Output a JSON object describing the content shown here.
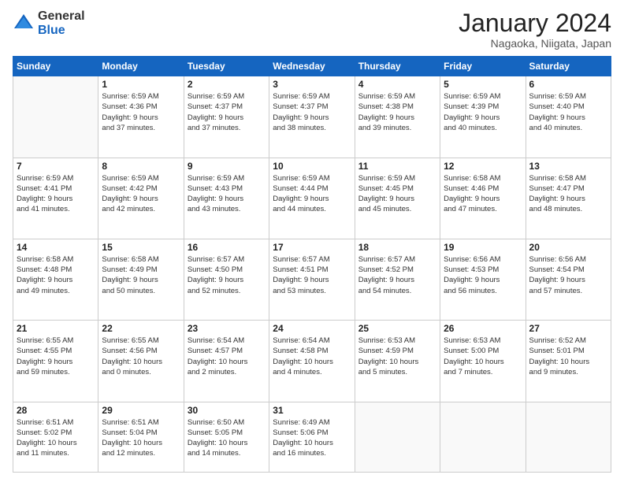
{
  "header": {
    "logo_general": "General",
    "logo_blue": "Blue",
    "title": "January 2024",
    "location": "Nagaoka, Niigata, Japan"
  },
  "weekdays": [
    "Sunday",
    "Monday",
    "Tuesday",
    "Wednesday",
    "Thursday",
    "Friday",
    "Saturday"
  ],
  "weeks": [
    [
      {
        "day": "",
        "info": ""
      },
      {
        "day": "1",
        "info": "Sunrise: 6:59 AM\nSunset: 4:36 PM\nDaylight: 9 hours\nand 37 minutes."
      },
      {
        "day": "2",
        "info": "Sunrise: 6:59 AM\nSunset: 4:37 PM\nDaylight: 9 hours\nand 37 minutes."
      },
      {
        "day": "3",
        "info": "Sunrise: 6:59 AM\nSunset: 4:37 PM\nDaylight: 9 hours\nand 38 minutes."
      },
      {
        "day": "4",
        "info": "Sunrise: 6:59 AM\nSunset: 4:38 PM\nDaylight: 9 hours\nand 39 minutes."
      },
      {
        "day": "5",
        "info": "Sunrise: 6:59 AM\nSunset: 4:39 PM\nDaylight: 9 hours\nand 40 minutes."
      },
      {
        "day": "6",
        "info": "Sunrise: 6:59 AM\nSunset: 4:40 PM\nDaylight: 9 hours\nand 40 minutes."
      }
    ],
    [
      {
        "day": "7",
        "info": ""
      },
      {
        "day": "8",
        "info": "Sunrise: 6:59 AM\nSunset: 4:42 PM\nDaylight: 9 hours\nand 42 minutes."
      },
      {
        "day": "9",
        "info": "Sunrise: 6:59 AM\nSunset: 4:43 PM\nDaylight: 9 hours\nand 43 minutes."
      },
      {
        "day": "10",
        "info": "Sunrise: 6:59 AM\nSunset: 4:44 PM\nDaylight: 9 hours\nand 44 minutes."
      },
      {
        "day": "11",
        "info": "Sunrise: 6:59 AM\nSunset: 4:45 PM\nDaylight: 9 hours\nand 45 minutes."
      },
      {
        "day": "12",
        "info": "Sunrise: 6:58 AM\nSunset: 4:46 PM\nDaylight: 9 hours\nand 47 minutes."
      },
      {
        "day": "13",
        "info": "Sunrise: 6:58 AM\nSunset: 4:47 PM\nDaylight: 9 hours\nand 48 minutes."
      }
    ],
    [
      {
        "day": "14",
        "info": ""
      },
      {
        "day": "15",
        "info": "Sunrise: 6:58 AM\nSunset: 4:49 PM\nDaylight: 9 hours\nand 50 minutes."
      },
      {
        "day": "16",
        "info": "Sunrise: 6:57 AM\nSunset: 4:50 PM\nDaylight: 9 hours\nand 52 minutes."
      },
      {
        "day": "17",
        "info": "Sunrise: 6:57 AM\nSunset: 4:51 PM\nDaylight: 9 hours\nand 53 minutes."
      },
      {
        "day": "18",
        "info": "Sunrise: 6:57 AM\nSunset: 4:52 PM\nDaylight: 9 hours\nand 54 minutes."
      },
      {
        "day": "19",
        "info": "Sunrise: 6:56 AM\nSunset: 4:53 PM\nDaylight: 9 hours\nand 56 minutes."
      },
      {
        "day": "20",
        "info": "Sunrise: 6:56 AM\nSunset: 4:54 PM\nDaylight: 9 hours\nand 57 minutes."
      }
    ],
    [
      {
        "day": "21",
        "info": ""
      },
      {
        "day": "22",
        "info": "Sunrise: 6:55 AM\nSunset: 4:56 PM\nDaylight: 10 hours\nand 0 minutes."
      },
      {
        "day": "23",
        "info": "Sunrise: 6:54 AM\nSunset: 4:57 PM\nDaylight: 10 hours\nand 2 minutes."
      },
      {
        "day": "24",
        "info": "Sunrise: 6:54 AM\nSunset: 4:58 PM\nDaylight: 10 hours\nand 4 minutes."
      },
      {
        "day": "25",
        "info": "Sunrise: 6:53 AM\nSunset: 4:59 PM\nDaylight: 10 hours\nand 5 minutes."
      },
      {
        "day": "26",
        "info": "Sunrise: 6:53 AM\nSunset: 5:00 PM\nDaylight: 10 hours\nand 7 minutes."
      },
      {
        "day": "27",
        "info": "Sunrise: 6:52 AM\nSunset: 5:01 PM\nDaylight: 10 hours\nand 9 minutes."
      }
    ],
    [
      {
        "day": "28",
        "info": "Sunrise: 6:51 AM\nSunset: 5:02 PM\nDaylight: 10 hours\nand 11 minutes."
      },
      {
        "day": "29",
        "info": "Sunrise: 6:51 AM\nSunset: 5:04 PM\nDaylight: 10 hours\nand 12 minutes."
      },
      {
        "day": "30",
        "info": "Sunrise: 6:50 AM\nSunset: 5:05 PM\nDaylight: 10 hours\nand 14 minutes."
      },
      {
        "day": "31",
        "info": "Sunrise: 6:49 AM\nSunset: 5:06 PM\nDaylight: 10 hours\nand 16 minutes."
      },
      {
        "day": "",
        "info": ""
      },
      {
        "day": "",
        "info": ""
      },
      {
        "day": "",
        "info": ""
      }
    ]
  ],
  "week1_sun_info": "Sunrise: 6:59 AM\nSunset: 4:41 PM\nDaylight: 9 hours\nand 41 minutes.",
  "week3_sun_info": "Sunrise: 6:58 AM\nSunset: 4:48 PM\nDaylight: 9 hours\nand 49 minutes.",
  "week4_sun_info": "Sunrise: 6:55 AM\nSunset: 4:55 PM\nDaylight: 9 hours\nand 59 minutes."
}
